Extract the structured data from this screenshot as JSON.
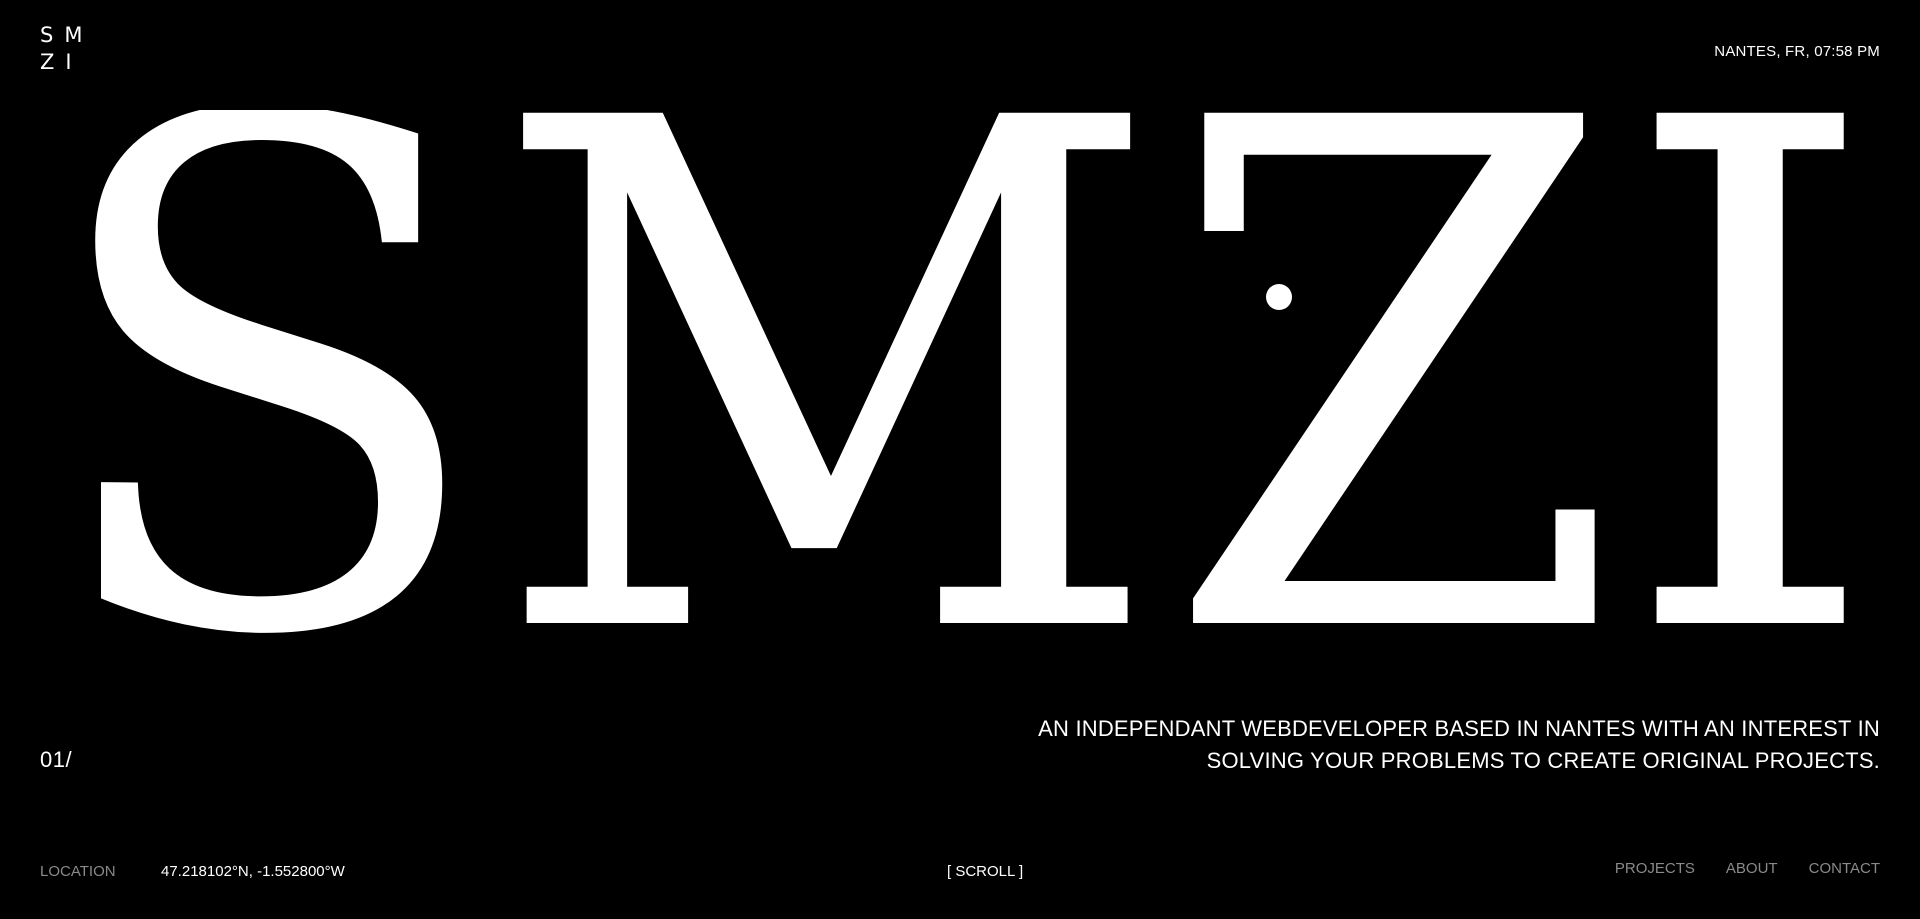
{
  "header": {
    "logo_line1": "SM",
    "logo_line2": "ZI",
    "clock": "NANTES, FR, 07:58 PM"
  },
  "hero": {
    "wordmark": "SMZI",
    "section_index": "01/",
    "tagline_line1": "AN INDEPENDANT WEBDEVELOPER BASED IN NANTES WITH AN INTEREST IN",
    "tagline_line2": "SOLVING YOUR PROBLEMS TO CREATE ORIGINAL PROJECTS."
  },
  "footer": {
    "location_label": "LOCATION",
    "coordinates": "47.218102°N, -1.552800°W",
    "scroll_hint": "[ SCROLL ]"
  },
  "nav": {
    "items": [
      {
        "label": "PROJECTS"
      },
      {
        "label": "ABOUT"
      },
      {
        "label": "CONTACT"
      }
    ]
  },
  "colors": {
    "background": "#000000",
    "foreground": "#ffffff",
    "muted": "#8a8a8a"
  }
}
